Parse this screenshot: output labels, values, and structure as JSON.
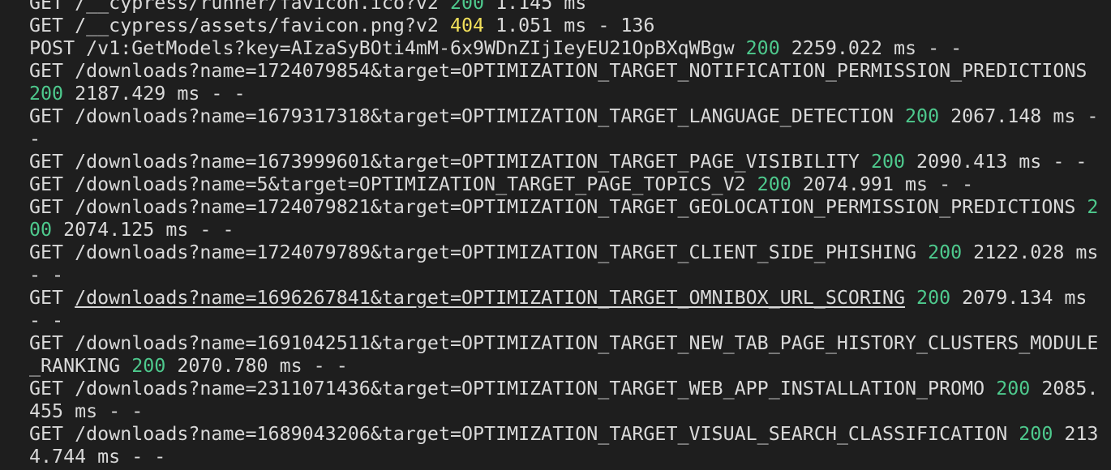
{
  "terminal": {
    "colors": {
      "background": "#1e1e1e",
      "text": "#d9d9d9",
      "status_ok": "#4ec98d",
      "status_not_found": "#f1e05a"
    },
    "lines": [
      {
        "method": "GET",
        "path": "/__cypress/runner/favicon.ico?v2",
        "status": "200",
        "status_class": "status-200",
        "rest": "1.145 ms",
        "underline": false
      },
      {
        "method": "GET",
        "path": "/__cypress/assets/favicon.png?v2",
        "status": "404",
        "status_class": "status-404",
        "rest": "1.051 ms - 136",
        "underline": false
      },
      {
        "method": "POST",
        "path": "/v1:GetModels?key=AIzaSyBOti4mM-6x9WDnZIjIeyEU21OpBXqWBgw",
        "status": "200",
        "status_class": "status-200",
        "rest": "2259.022 ms - -",
        "underline": false
      },
      {
        "method": "GET",
        "path": "/downloads?name=1724079854&target=OPTIMIZATION_TARGET_NOTIFICATION_PERMISSION_PREDICTIONS",
        "status": "200",
        "status_class": "status-200",
        "rest": "2187.429 ms - -",
        "underline": false
      },
      {
        "method": "GET",
        "path": "/downloads?name=1679317318&target=OPTIMIZATION_TARGET_LANGUAGE_DETECTION",
        "status": "200",
        "status_class": "status-200",
        "rest": "2067.148 ms - -",
        "underline": false
      },
      {
        "method": "GET",
        "path": "/downloads?name=1673999601&target=OPTIMIZATION_TARGET_PAGE_VISIBILITY",
        "status": "200",
        "status_class": "status-200",
        "rest": "2090.413 ms - -",
        "underline": false
      },
      {
        "method": "GET",
        "path": "/downloads?name=5&target=OPTIMIZATION_TARGET_PAGE_TOPICS_V2",
        "status": "200",
        "status_class": "status-200",
        "rest": "2074.991 ms - -",
        "underline": false
      },
      {
        "method": "GET",
        "path": "/downloads?name=1724079821&target=OPTIMIZATION_TARGET_GEOLOCATION_PERMISSION_PREDICTIONS",
        "status": "200",
        "status_class": "status-200",
        "rest": "2074.125 ms - -",
        "underline": false
      },
      {
        "method": "GET",
        "path": "/downloads?name=1724079789&target=OPTIMIZATION_TARGET_CLIENT_SIDE_PHISHING",
        "status": "200",
        "status_class": "status-200",
        "rest": "2122.028 ms - -",
        "underline": false
      },
      {
        "method": "GET",
        "path": "/downloads?name=1696267841&target=OPTIMIZATION_TARGET_OMNIBOX_URL_SCORING",
        "status": "200",
        "status_class": "status-200",
        "rest": "2079.134 ms - -",
        "underline": true
      },
      {
        "method": "GET",
        "path": "/downloads?name=1691042511&target=OPTIMIZATION_TARGET_NEW_TAB_PAGE_HISTORY_CLUSTERS_MODULE_RANKING",
        "status": "200",
        "status_class": "status-200",
        "rest": "2070.780 ms - -",
        "underline": false
      },
      {
        "method": "GET",
        "path": "/downloads?name=2311071436&target=OPTIMIZATION_TARGET_WEB_APP_INSTALLATION_PROMO",
        "status": "200",
        "status_class": "status-200",
        "rest": "2085.455 ms - -",
        "underline": false
      },
      {
        "method": "GET",
        "path": "/downloads?name=1689043206&target=OPTIMIZATION_TARGET_VISUAL_SEARCH_CLASSIFICATION",
        "status": "200",
        "status_class": "status-200",
        "rest": "2134.744 ms - -",
        "underline": false
      }
    ]
  }
}
